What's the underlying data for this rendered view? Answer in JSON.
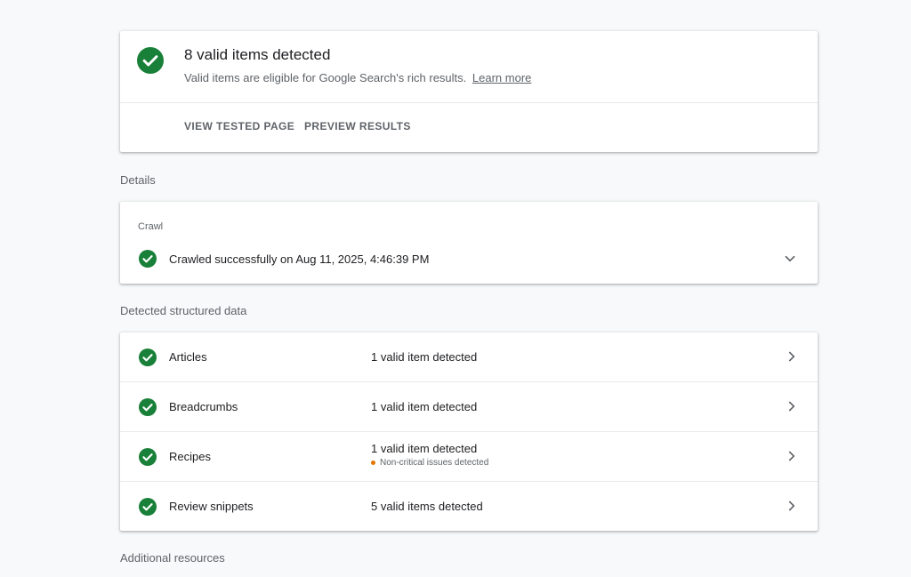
{
  "colors": {
    "valid_green": "#188038",
    "warning_orange": "#e37400",
    "text_primary": "#202124",
    "text_secondary": "#5f6368"
  },
  "summary": {
    "icon": "check-circle-icon",
    "title": "8 valid items detected",
    "subtitle": "Valid items are eligible for Google Search's rich results.",
    "learn_more": "Learn more",
    "actions": {
      "view_tested_page": "VIEW TESTED PAGE",
      "preview_results": "PREVIEW RESULTS"
    }
  },
  "sections": {
    "details": "Details",
    "structured": "Detected structured data",
    "additional": "Additional resources"
  },
  "crawl": {
    "heading": "Crawl",
    "status": "Crawled successfully on Aug 11, 2025, 4:46:39 PM",
    "icon": "check-circle-icon",
    "expand_icon": "chevron-down-icon"
  },
  "structured_data": {
    "items": [
      {
        "name": "Articles",
        "status": "1 valid item detected",
        "note": ""
      },
      {
        "name": "Breadcrumbs",
        "status": "1 valid item detected",
        "note": ""
      },
      {
        "name": "Recipes",
        "status": "1 valid item detected",
        "note": "Non-critical issues detected"
      },
      {
        "name": "Review snippets",
        "status": "5 valid items detected",
        "note": ""
      }
    ]
  }
}
